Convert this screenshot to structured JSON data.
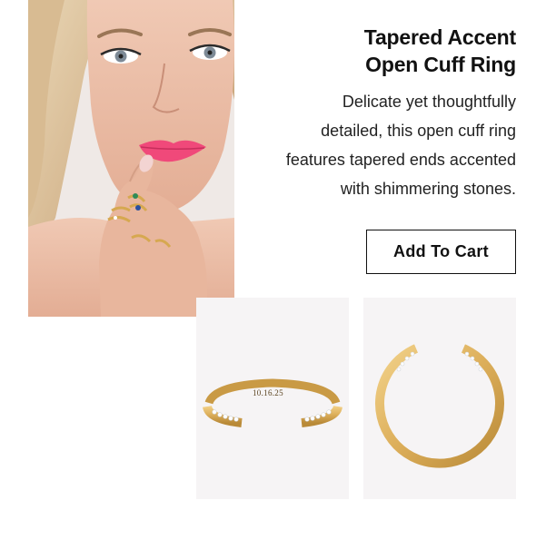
{
  "product": {
    "title_line1": "Tapered Accent",
    "title_line2": "Open Cuff Ring",
    "description_lines": [
      "Delicate yet thoughtfully",
      "detailed, this open cuff ring",
      "features tapered ends accented",
      "with shimmering stones."
    ],
    "add_to_cart_label": "Add To Cart",
    "engraving": "10.16.25"
  },
  "colors": {
    "gold": "#dcae5a",
    "gold_dark": "#b98a38",
    "text": "#111111",
    "thumb_bg": "#f6f4f5"
  }
}
